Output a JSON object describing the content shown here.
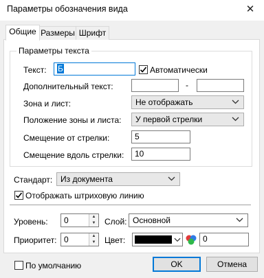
{
  "window": {
    "title": "Параметры обозначения вида",
    "close_glyph": "✕"
  },
  "tabs": [
    {
      "label": "Общие",
      "active": true
    },
    {
      "label": "Размеры",
      "active": false
    },
    {
      "label": "Шрифт",
      "active": false
    }
  ],
  "text_params": {
    "group_title": "Параметры текста",
    "text_label": "Текст:",
    "text_value": "Б",
    "auto_label": "Автоматически",
    "auto_checked": true,
    "extra_text_label": "Дополнительный текст:",
    "extra_text_value1": "",
    "extra_text_dash": "-",
    "extra_text_value2": "",
    "zone_label": "Зона и лист:",
    "zone_value": "Не отображать",
    "zone_pos_label": "Положение зоны и листа:",
    "zone_pos_value": "У первой стрелки",
    "offset_arrow_label": "Смещение от стрелки:",
    "offset_arrow_value": "5",
    "offset_along_label": "Смещение вдоль стрелки:",
    "offset_along_value": "10"
  },
  "standard": {
    "label": "Стандарт:",
    "value": "Из документа"
  },
  "hatch": {
    "label": "Отображать штриховую линию",
    "checked": true
  },
  "bottom": {
    "level_label": "Уровень:",
    "level_value": "0",
    "layer_label": "Слой:",
    "layer_value": "Основной",
    "priority_label": "Приоритет:",
    "priority_value": "0",
    "color_label": "Цвет:",
    "color_swatch": "#000000",
    "color_value": "0"
  },
  "footer": {
    "default_label": "По умолчанию",
    "default_checked": false,
    "ok_label": "OK",
    "cancel_label": "Отмена"
  },
  "colors": {
    "accent": "#0078d7",
    "check": "#000000"
  }
}
